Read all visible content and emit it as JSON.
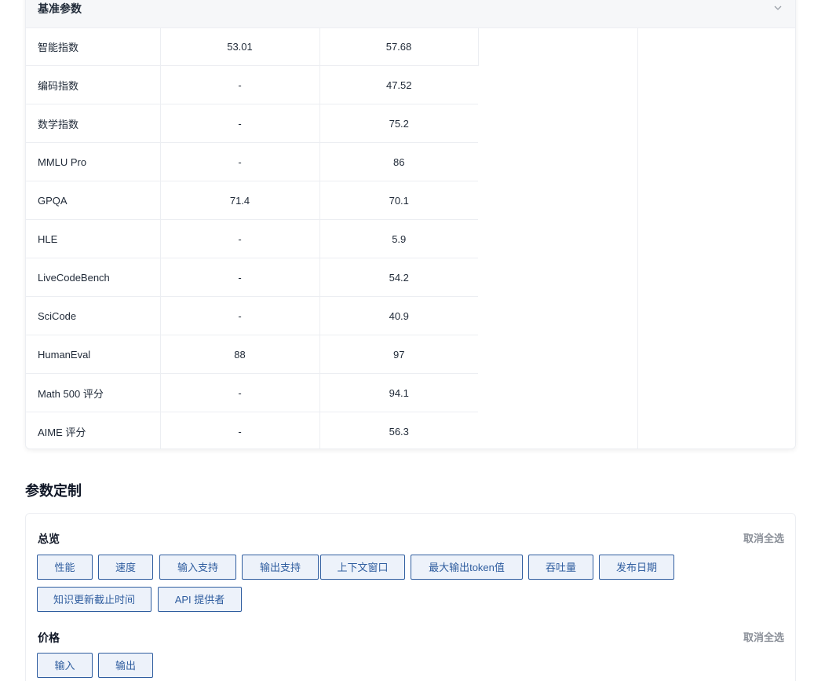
{
  "benchmark": {
    "title": "基准参数",
    "rows": [
      {
        "name": "智能指数",
        "v1": "53.01",
        "v2": "57.68"
      },
      {
        "name": "编码指数",
        "v1": "-",
        "v2": "47.52"
      },
      {
        "name": "数学指数",
        "v1": "-",
        "v2": "75.2"
      },
      {
        "name": "MMLU Pro",
        "v1": "-",
        "v2": "86"
      },
      {
        "name": "GPQA",
        "v1": "71.4",
        "v2": "70.1"
      },
      {
        "name": "HLE",
        "v1": "-",
        "v2": "5.9"
      },
      {
        "name": "LiveCodeBench",
        "v1": "-",
        "v2": "54.2"
      },
      {
        "name": "SciCode",
        "v1": "-",
        "v2": "40.9"
      },
      {
        "name": "HumanEval",
        "v1": "88",
        "v2": "97"
      },
      {
        "name": "Math 500 评分",
        "v1": "-",
        "v2": "94.1"
      },
      {
        "name": "AIME 评分",
        "v1": "-",
        "v2": "56.3"
      }
    ]
  },
  "customize": {
    "title": "参数定制",
    "overview": {
      "title": "总览",
      "deselect_label": "取消全选",
      "tags": [
        "性能",
        "速度",
        "输入支持",
        "输出支持",
        "上下文窗口",
        "最大输出token值",
        "吞吐量",
        "发布日期",
        "知识更新截止时间",
        "API 提供者"
      ]
    },
    "price": {
      "title": "价格",
      "deselect_label": "取消全选",
      "tags": [
        "输入",
        "输出"
      ]
    }
  },
  "colors": {
    "tag_border": "#2f5d9f",
    "tag_bg": "#edf2fa",
    "muted_text": "#8a8f98"
  },
  "icons": {
    "collapse": "chevron-down-icon"
  }
}
